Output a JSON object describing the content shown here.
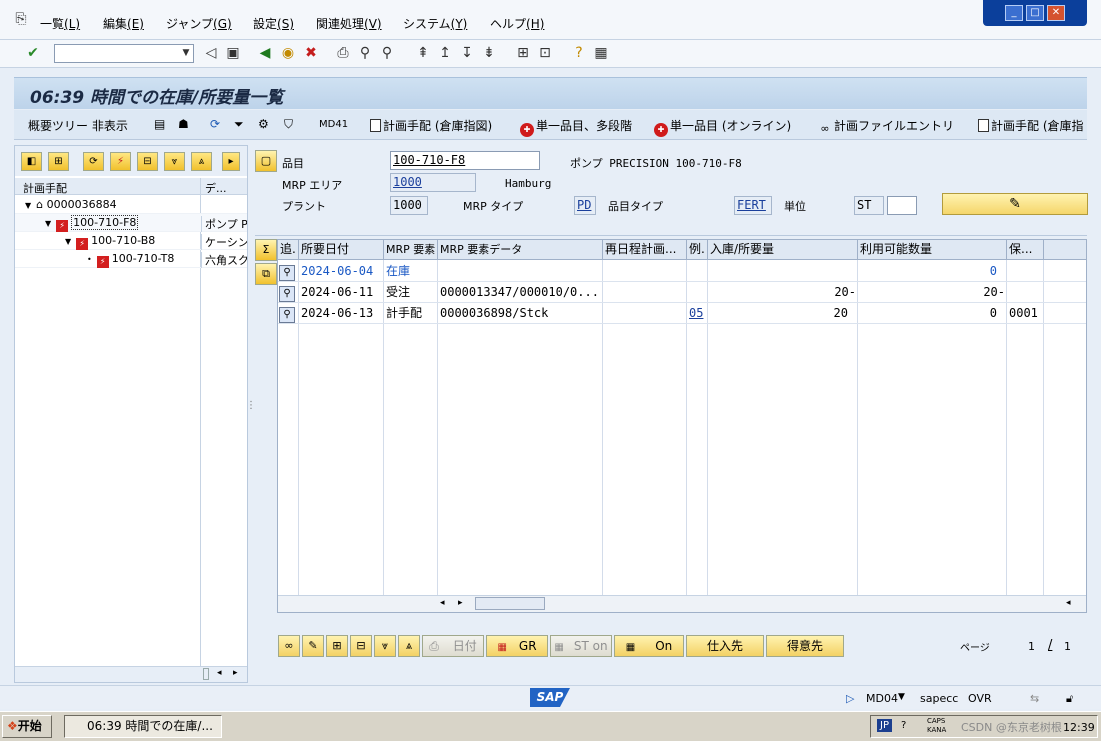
{
  "menu": {
    "items": [
      {
        "label": "一覧",
        "mnemonic": "(L)"
      },
      {
        "label": "編集",
        "mnemonic": "(E)"
      },
      {
        "label": "ジャンプ",
        "mnemonic": "(G)"
      },
      {
        "label": "設定",
        "mnemonic": "(S)"
      },
      {
        "label": "関連処理",
        "mnemonic": "(V)"
      },
      {
        "label": "システム",
        "mnemonic": "(Y)"
      },
      {
        "label": "ヘルプ",
        "mnemonic": "(H)"
      }
    ]
  },
  "title": "06:39 時間での在庫/所要量一覧",
  "app_toolbar": {
    "overview_tree_hide": "概要ツリー 非表示",
    "md41": "MD41",
    "planned_order_storage": "計画手配 (倉庫指図)",
    "single_item_multilevel": "単一品目、多段階",
    "single_item_online": "単一品目 (オンライン)",
    "planning_file_entry": "計画ファイルエントリ",
    "planned_order_storage_cut": "計画手配 (倉庫指"
  },
  "tree": {
    "col1_header": "計画手配",
    "col2_header": "デ...",
    "rows": [
      {
        "code": "0000036884",
        "desc": ""
      },
      {
        "code": "100-710-F8",
        "desc": "ポンプ P"
      },
      {
        "code": "100-710-B8",
        "desc": "ケーシン"
      },
      {
        "code": "100-710-T8",
        "desc": "六角スク"
      }
    ]
  },
  "header": {
    "material_label": "品目",
    "material_value": "100-710-F8",
    "material_desc": "ポンプ PRECISION 100-710-F8",
    "mrp_area_label": "MRP エリア",
    "mrp_area_value": "1000",
    "mrp_area_desc": "Hamburg",
    "plant_label": "プラント",
    "plant_value": "1000",
    "mrp_type_label": "MRP タイプ",
    "mrp_type_value": "PD",
    "material_type_label": "品目タイプ",
    "material_type_value": "FERT",
    "unit_label": "単位",
    "unit_value": "ST",
    "unit_extra": ""
  },
  "grid": {
    "columns": [
      "追.",
      "所要日付",
      "MRP 要素",
      "MRP 要素データ",
      "再日程計画...",
      "例.",
      "入庫/所要量",
      "利用可能数量",
      "保..."
    ],
    "rows": [
      {
        "date": "2024-06-04",
        "element": "在庫",
        "data": "",
        "resched": "",
        "exc": "",
        "qty": "",
        "avail": "0",
        "stor": ""
      },
      {
        "date": "2024-06-11",
        "element": "受注",
        "data": "0000013347/000010/0...",
        "resched": "",
        "exc": "",
        "qty": "20-",
        "avail": "20-",
        "stor": ""
      },
      {
        "date": "2024-06-13",
        "element": "計手配",
        "data": "0000036898/Stck",
        "resched": "",
        "exc": "05",
        "qty": "20",
        "avail": "0",
        "stor": "0001"
      }
    ]
  },
  "bottom_buttons": {
    "date": "日付",
    "gr": "GR",
    "st_on": "ST on",
    "on": "On",
    "vendor": "仕入先",
    "customer": "得意先"
  },
  "pager": {
    "label": "ページ",
    "current": "1",
    "sep": "/",
    "total": "1"
  },
  "status": {
    "sap_logo": "SAP",
    "tcode": "MD04",
    "server": "sapecc",
    "mode": "OVR"
  },
  "taskbar": {
    "start": "开始",
    "task": "06:39 時間での在庫/...",
    "lang": "JP",
    "ime": "CAPS KANA",
    "clock": "12:39",
    "watermark": "CSDN @东京老树根"
  },
  "colors": {
    "accent": "#2264c4",
    "title_bg": "#c7dbef",
    "button_yellow": "#f5d66b"
  }
}
